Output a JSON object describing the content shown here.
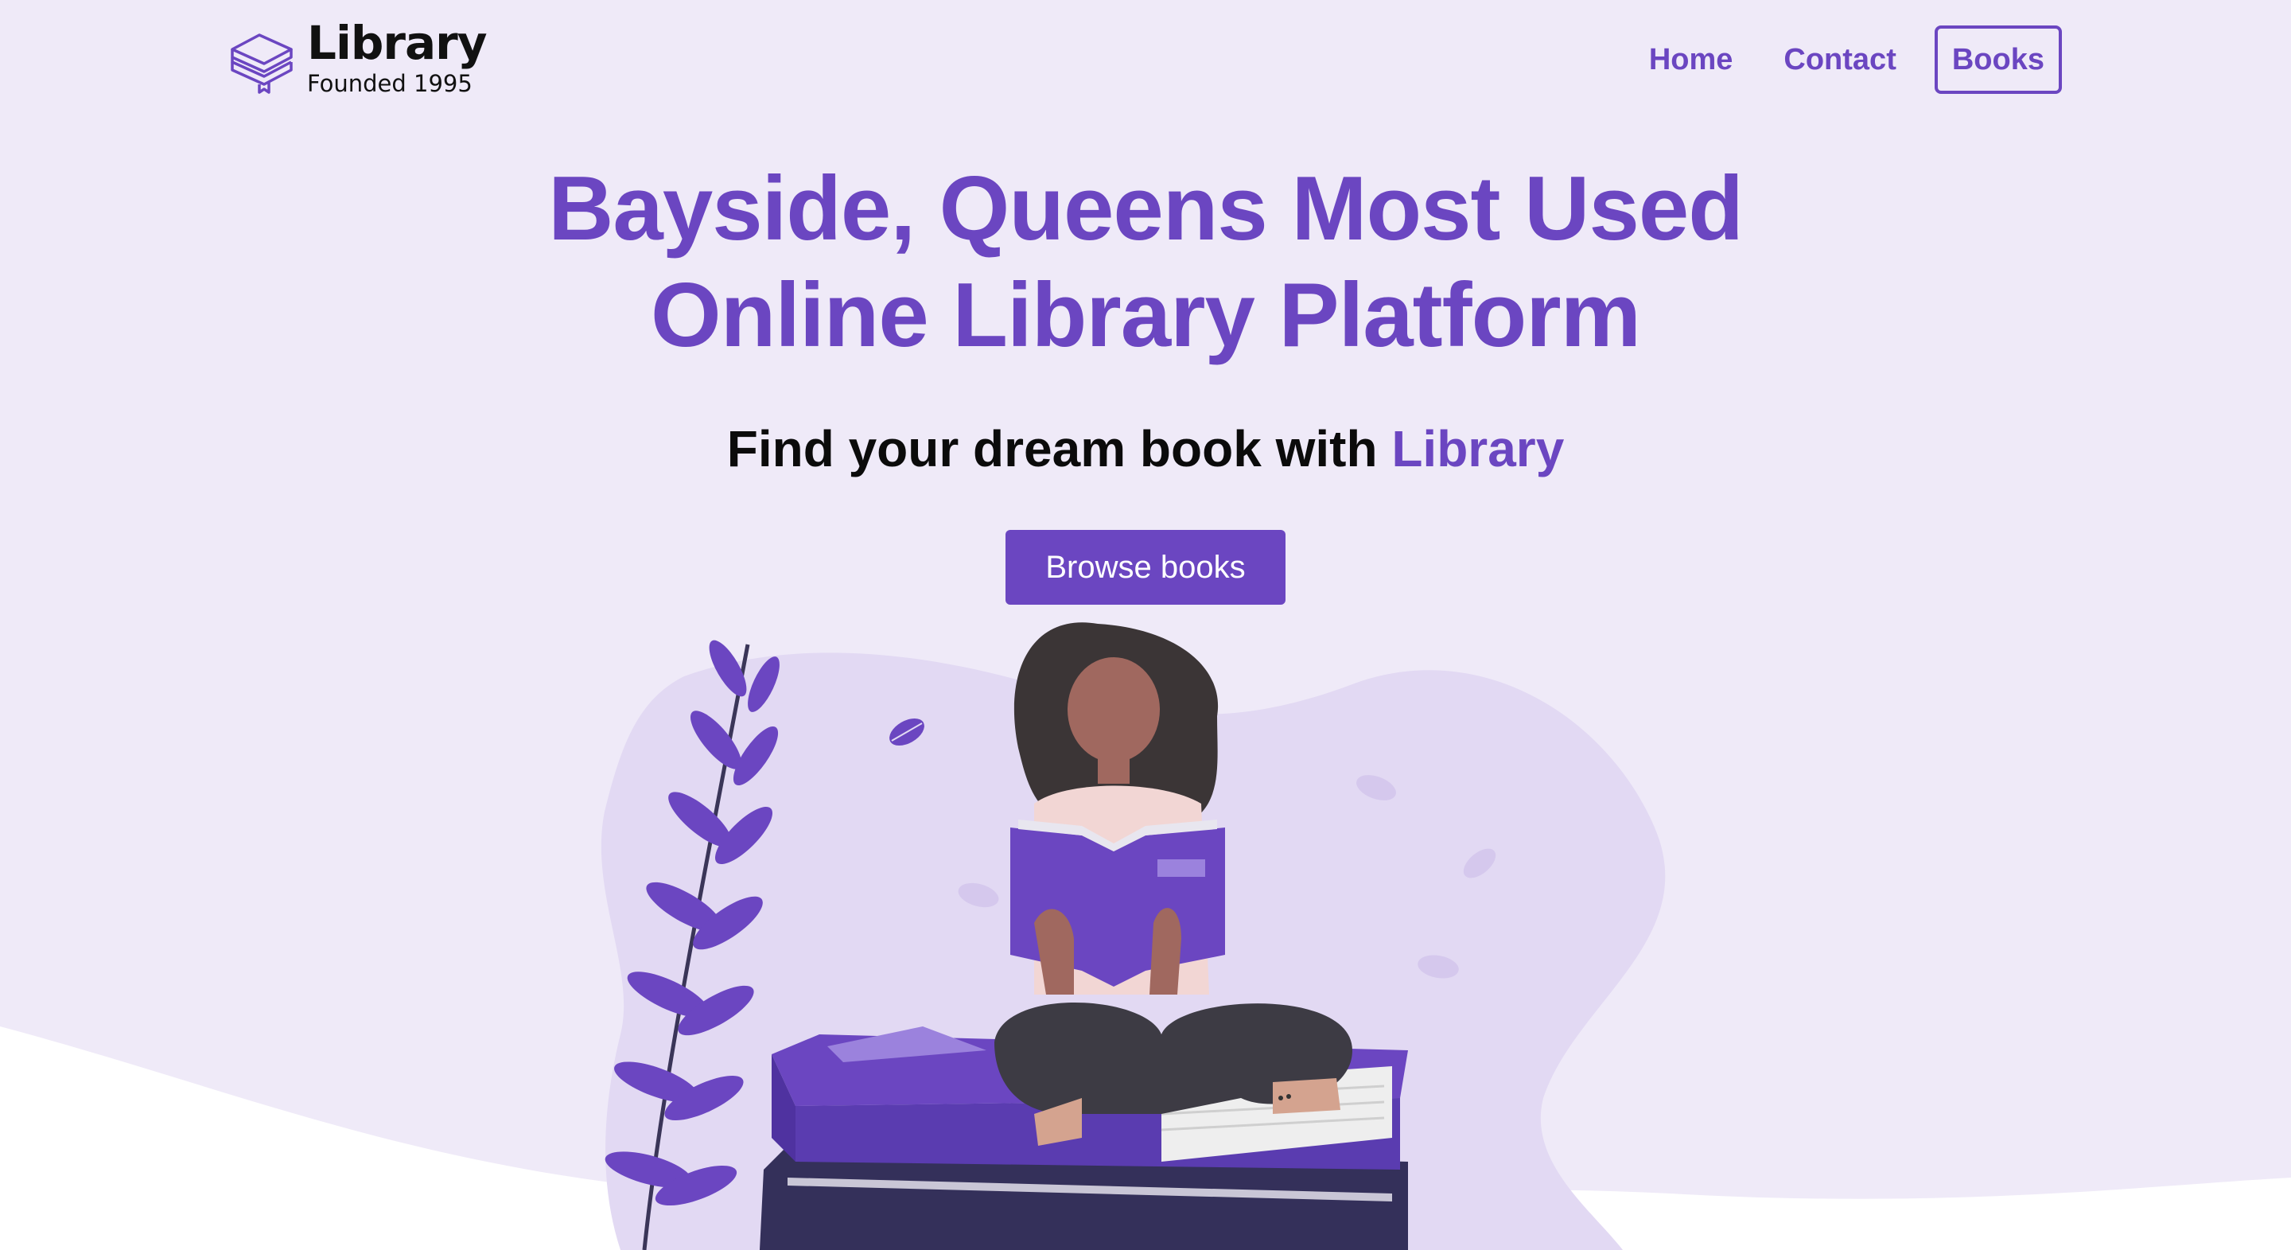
{
  "brand": {
    "name": "Library",
    "subtitle": "Founded 1995",
    "icon": "stacked-books-icon"
  },
  "nav": {
    "home": "Home",
    "contact": "Contact",
    "books": "Books"
  },
  "hero": {
    "title_line1": "Bayside, Queens Most Used",
    "title_line2": "Online Library Platform",
    "tagline_prefix": "Find your dream book with ",
    "tagline_accent": "Library",
    "cta": "Browse books"
  },
  "illustration": {
    "subject": "woman-reading-on-books-illustration"
  },
  "colors": {
    "accent": "#6b46c1",
    "background": "#efeaf8",
    "blob": "#e2d9f3"
  }
}
